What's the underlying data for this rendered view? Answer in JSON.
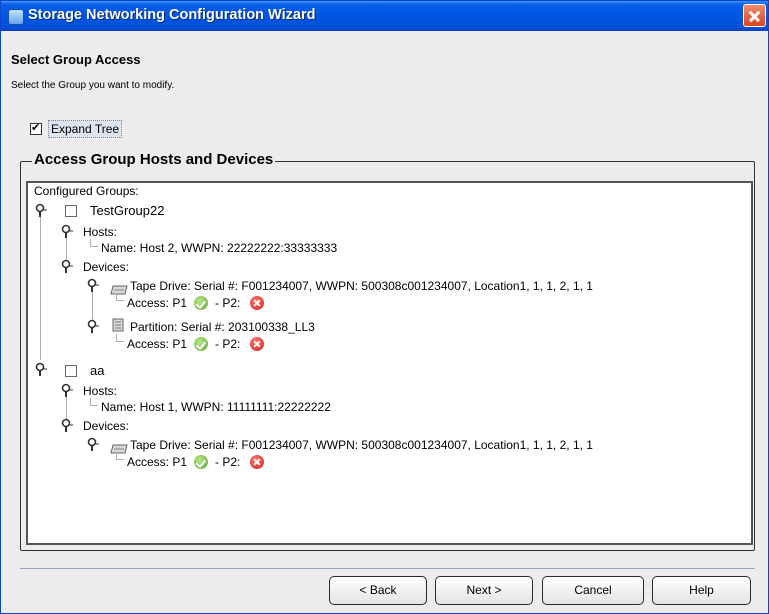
{
  "window": {
    "title": "Storage Networking Configuration Wizard"
  },
  "header": {
    "title": "Select Group Access",
    "subtitle": "Select the Group you want to modify."
  },
  "expand_tree": {
    "label": "Expand Tree",
    "checked": true
  },
  "groupbox": {
    "title": "Access Group Hosts and Devices"
  },
  "tree": {
    "root_label": "Configured Groups:",
    "groups": [
      {
        "name": "TestGroup22",
        "hosts_label": "Hosts:",
        "hosts": [
          "Name: Host 2, WWPN: 22222222:33333333"
        ],
        "devices_label": "Devices:",
        "devices": [
          {
            "type": "tape-drive",
            "label": "Tape Drive: Serial #: F001234007, WWPN: 500308c001234007, Location1, 1, 1, 2, 1, 1",
            "access_p1": "Access: P1",
            "access_p2": "- P2:",
            "p1_ok": true,
            "p2_ok": false
          },
          {
            "type": "partition",
            "label": "Partition: Serial #: 203100338_LL3",
            "access_p1": "Access: P1",
            "access_p2": "- P2:",
            "p1_ok": true,
            "p2_ok": false
          }
        ]
      },
      {
        "name": "aa",
        "hosts_label": "Hosts:",
        "hosts": [
          "Name: Host 1, WWPN: 11111111:22222222"
        ],
        "devices_label": "Devices:",
        "devices": [
          {
            "type": "tape-drive",
            "label": "Tape Drive: Serial #: F001234007, WWPN: 500308c001234007, Location1, 1, 1, 2, 1, 1",
            "access_p1": "Access: P1",
            "access_p2": "- P2:",
            "p1_ok": true,
            "p2_ok": false
          }
        ]
      }
    ]
  },
  "buttons": {
    "back": "< Back",
    "next": "Next >",
    "cancel": "Cancel",
    "help": "Help"
  },
  "colors": {
    "titlebar": "#0056e3",
    "ok": "#5aa637",
    "error": "#d51f1f"
  }
}
